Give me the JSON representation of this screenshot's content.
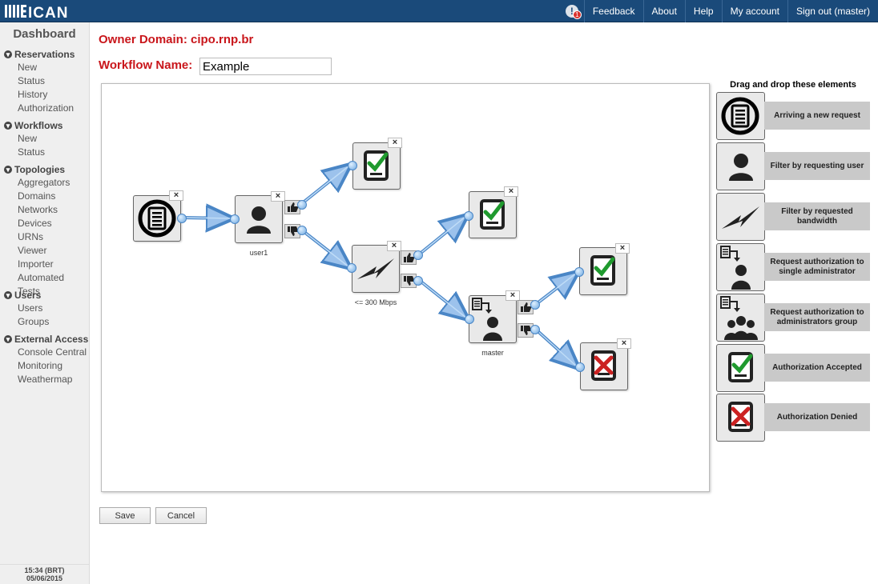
{
  "app": {
    "logo_text": "MEICAN"
  },
  "topnav": {
    "alert_count": "1",
    "items": [
      "Feedback",
      "About",
      "Help",
      "My account",
      "Sign out (master)"
    ]
  },
  "sidebar": {
    "title": "Dashboard",
    "sections": [
      {
        "label": "Reservations",
        "items": [
          "New",
          "Status",
          "History",
          "Authorization"
        ]
      },
      {
        "label": "Workflows",
        "items": [
          "New",
          "Status"
        ]
      },
      {
        "label": "Topologies",
        "items": [
          "Aggregators",
          "Domains",
          "Networks",
          "Devices",
          "URNs",
          "Viewer",
          "Importer",
          "Automated Tests"
        ]
      },
      {
        "label": "Users",
        "items": [
          "Users",
          "Groups"
        ]
      },
      {
        "label": "External Access",
        "items": [
          "Console Central",
          "Monitoring",
          "Weathermap"
        ]
      }
    ],
    "clock_time": "15:34 (BRT)",
    "clock_date": "05/06/2015"
  },
  "page": {
    "owner_domain": "Owner Domain: cipo.rnp.br",
    "workflow_name_label": "Workflow Name:",
    "workflow_name_value": "Example"
  },
  "canvas": {
    "close_glyph": "×",
    "labels": {
      "user_node": "user1",
      "bandwidth_node": "<= 300 Mbps",
      "admin_node": "master"
    }
  },
  "palette": {
    "title": "Drag and drop these elements",
    "items": [
      {
        "label": "Arriving a new request",
        "icon": "new-request-icon"
      },
      {
        "label": "Filter by requesting user",
        "icon": "user-filter-icon"
      },
      {
        "label": "Filter by requested bandwidth",
        "icon": "bandwidth-filter-icon"
      },
      {
        "label": "Request authorization to single administrator",
        "icon": "single-admin-icon"
      },
      {
        "label": "Request authorization to administrators group",
        "icon": "admin-group-icon"
      },
      {
        "label": "Authorization Accepted",
        "icon": "accepted-icon"
      },
      {
        "label": "Authorization Denied",
        "icon": "denied-icon"
      }
    ]
  },
  "actions": {
    "save": "Save",
    "cancel": "Cancel"
  },
  "colors": {
    "topbar": "#1a4a7a",
    "accent_red": "#c9161b",
    "accept_green": "#1f9a2e",
    "deny_red": "#cc2222",
    "connector_blue": "#4a86c6"
  }
}
